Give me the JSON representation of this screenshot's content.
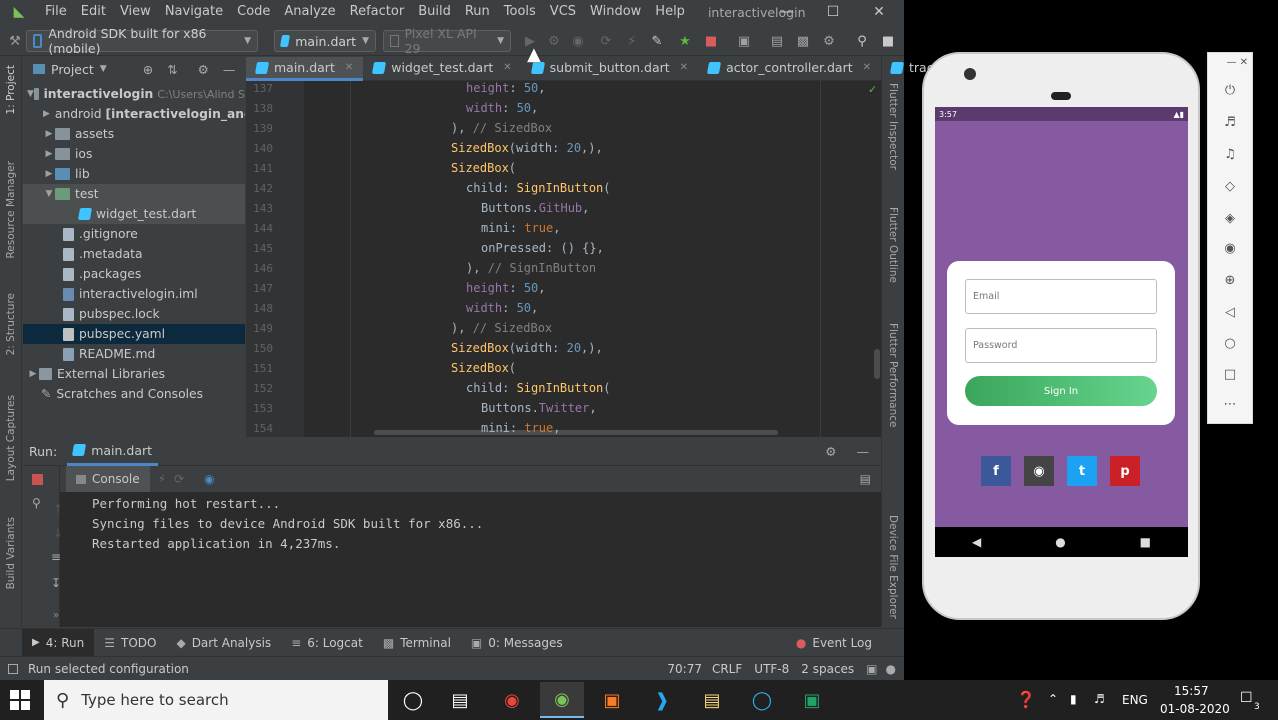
{
  "menu": {
    "logo": "◣",
    "items": [
      "File",
      "Edit",
      "View",
      "Navigate",
      "Code",
      "Analyze",
      "Refactor",
      "Build",
      "Run",
      "Tools",
      "VCS",
      "Window",
      "Help"
    ],
    "window_title": "interactivelogin"
  },
  "toolbar": {
    "device_select": "Android SDK built for x86 (mobile)",
    "run_config": "main.dart",
    "emulator_select": "Pixel XL API 29"
  },
  "left_strip": {
    "project": "1: Project",
    "resource_manager": "Resource Manager",
    "structure": "2: Structure",
    "layout_captures": "Layout Captures",
    "build_variants": "Build Variants"
  },
  "right_strip": {
    "flutter_inspector": "Flutter Inspector",
    "flutter_outline": "Flutter Outline",
    "flutter_performance": "Flutter Performance",
    "device_file_explorer": "Device File Explorer"
  },
  "project": {
    "header": "Project",
    "root_name": "interactivelogin",
    "root_path": "C:\\Users\\Alind S",
    "android": "android",
    "android_module": "[interactivelogin_and",
    "assets": "assets",
    "ios": "ios",
    "lib": "lib",
    "test": "test",
    "widget_test": "widget_test.dart",
    "gitignore": ".gitignore",
    "metadata": ".metadata",
    "packages": ".packages",
    "iml": "interactivelogin.iml",
    "pubspec_lock": "pubspec.lock",
    "pubspec_yaml": "pubspec.yaml",
    "readme": "README.md",
    "external": "External Libraries",
    "scratches": "Scratches and Consoles"
  },
  "tabs": {
    "t1": "main.dart",
    "t2": "widget_test.dart",
    "t3": "submit_button.dart",
    "t4": "actor_controller.dart",
    "t5": "track",
    "more": "»2"
  },
  "editor": {
    "lines": [
      "137",
      "138",
      "139",
      "140",
      "141",
      "142",
      "143",
      "144",
      "145",
      "146",
      "147",
      "148",
      "149",
      "150",
      "151",
      "152",
      "153",
      "154"
    ],
    "l137_a": "height",
    "l137_b": "50",
    "l138_a": "width",
    "l138_b": "50",
    "l139_a": "),",
    "l139_b": "// SizedBox",
    "l140_a": "SizedBox",
    "l140_b": "(width: ",
    "l140_c": "20",
    "l140_d": ",),",
    "l141_a": "SizedBox",
    "l141_b": "(",
    "l142_a": "child: ",
    "l142_b": "SignInButton",
    "l142_c": "(",
    "l143_a": "Buttons.",
    "l143_b": "GitHub",
    "l143_c": ",",
    "l144_a": "mini: ",
    "l144_b": "true",
    "l144_c": ",",
    "l145": "onPressed: () {},",
    "l146_a": "),",
    "l146_b": "// SignInButton",
    "l147_a": "height",
    "l147_b": "50",
    "l148_a": "width",
    "l148_b": "50",
    "l149_a": "),",
    "l149_b": "// SizedBox",
    "l150_a": "SizedBox",
    "l150_b": "(width: ",
    "l150_c": "20",
    "l150_d": ",),",
    "l151_a": "SizedBox",
    "l151_b": "(",
    "l152_a": "child: ",
    "l152_b": "SignInButton",
    "l152_c": "(",
    "l153_a": "Buttons.",
    "l153_b": "Twitter",
    "l153_c": ",",
    "l154_a": "mini: ",
    "l154_b": "true",
    "l154_c": ","
  },
  "run": {
    "label": "Run:",
    "config": "main.dart",
    "console": "Console",
    "out1": "Performing hot restart...",
    "out2": "Syncing files to device Android SDK built for x86...",
    "out3": "Restarted application in 4,237ms."
  },
  "bottom_tools": {
    "run": "4: Run",
    "todo": "TODO",
    "dart_analysis": "Dart Analysis",
    "logcat": "6: Logcat",
    "terminal": "Terminal",
    "messages": "0: Messages",
    "event_log": "Event Log"
  },
  "status": {
    "message": "Run selected configuration",
    "position": "70:77",
    "line_sep": "CRLF",
    "encoding": "UTF-8",
    "indent": "2 spaces"
  },
  "phone": {
    "time": "3:57",
    "email_placeholder": "Email",
    "password_placeholder": "Password",
    "signin": "Sign In",
    "social": [
      "f",
      "◉",
      "t",
      "p"
    ]
  },
  "taskbar": {
    "search_placeholder": "Type here to search",
    "lang": "ENG",
    "time": "15:57",
    "date": "01-08-2020",
    "notifications": "3"
  },
  "colors": {
    "ide_bg": "#3c3f41",
    "editor_bg": "#2b2b2b",
    "phone_bg": "#855aa0",
    "signin_green": "#3aa65c"
  }
}
